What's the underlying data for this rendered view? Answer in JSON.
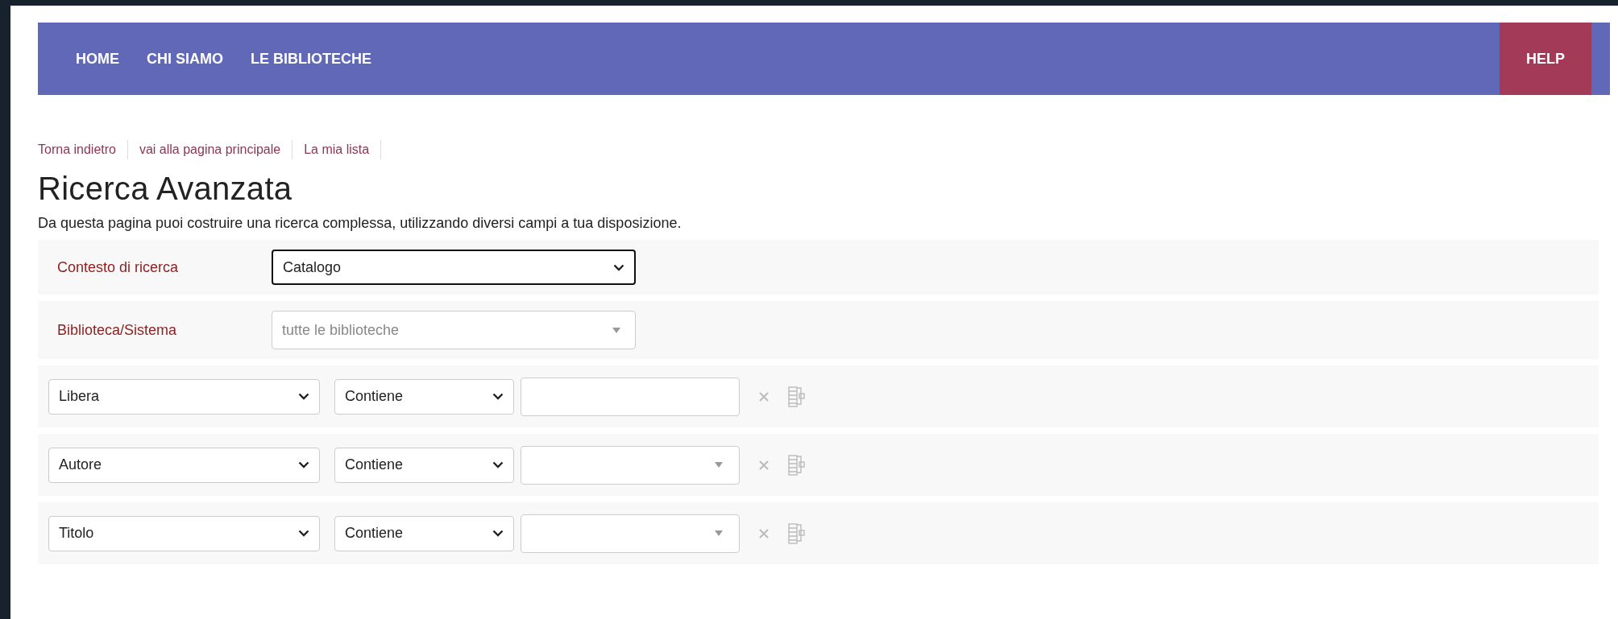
{
  "nav": {
    "items": [
      {
        "label": "HOME"
      },
      {
        "label": "CHI SIAMO"
      },
      {
        "label": "LE BIBLIOTECHE"
      }
    ],
    "help": "HELP"
  },
  "breadcrumbs": [
    "Torna indietro",
    "vai alla pagina principale",
    "La mia lista"
  ],
  "title": "Ricerca Avanzata",
  "description": "Da questa pagina puoi costruire una ricerca complessa, utilizzando diversi campi a tua disposizione.",
  "context": {
    "label": "Contesto di ricerca",
    "value": "Catalogo",
    "focused": true
  },
  "library": {
    "label": "Biblioteca/Sistema",
    "placeholder": "tutte le biblioteche"
  },
  "criteria": [
    {
      "field": "Libera",
      "operator": "Contiene",
      "kind": "text"
    },
    {
      "field": "Autore",
      "operator": "Contiene",
      "kind": "combo"
    },
    {
      "field": "Titolo",
      "operator": "Contiene",
      "kind": "combo"
    }
  ]
}
